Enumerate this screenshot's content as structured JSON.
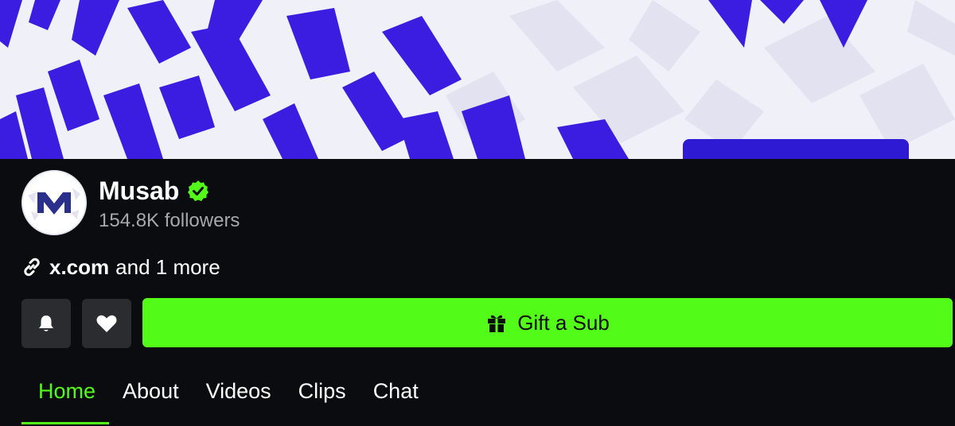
{
  "colors": {
    "accent": "#53fc18",
    "background": "#0b0c0f",
    "button_bg": "#2a2c30",
    "muted_text": "#a6a8ad",
    "banner_blue": "#3a1de0"
  },
  "banner": {
    "icon": "brand-pattern-banner"
  },
  "profile": {
    "name": "Musab",
    "verified_icon": "verified-badge-icon",
    "followers": "154.8K followers"
  },
  "links": {
    "icon": "link-icon",
    "main": "x.com",
    "more": "and 1 more"
  },
  "actions": {
    "notify_icon": "bell-icon",
    "follow_icon": "heart-icon",
    "gift_icon": "gift-icon",
    "gift_label": "Gift a Sub"
  },
  "tabs": [
    {
      "label": "Home",
      "active": true
    },
    {
      "label": "About",
      "active": false
    },
    {
      "label": "Videos",
      "active": false
    },
    {
      "label": "Clips",
      "active": false
    },
    {
      "label": "Chat",
      "active": false
    }
  ]
}
